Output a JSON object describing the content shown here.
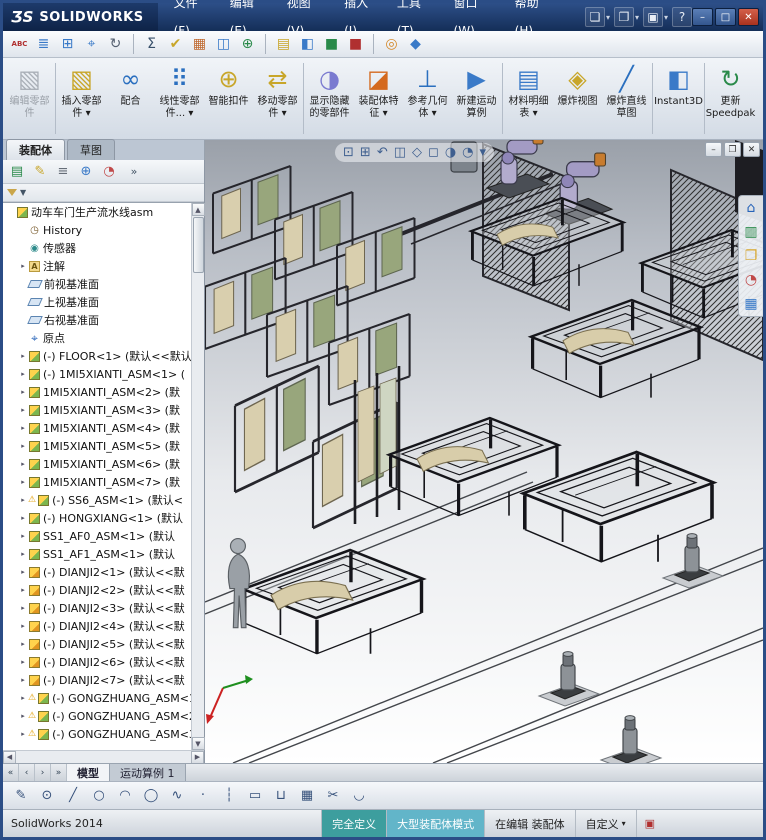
{
  "window": {
    "logo_zs": "ƷS",
    "logo_name": "SOLIDWORKS",
    "menus": [
      "文件(F)",
      "编辑(E)",
      "视图(V)",
      "插入(I)",
      "工具(T)",
      "窗口(W)",
      "帮助(H)"
    ],
    "quick_icons": [
      {
        "name": "new-document-icon",
        "glyph": "❏",
        "arrow": true
      },
      {
        "name": "open-document-icon",
        "glyph": "❐",
        "arrow": true
      },
      {
        "name": "save-icon",
        "glyph": "▣",
        "arrow": true
      },
      {
        "name": "help-icon",
        "glyph": "?"
      }
    ],
    "controls": [
      {
        "name": "minimize-button",
        "glyph": "–",
        "kind": "min"
      },
      {
        "name": "maximize-button",
        "glyph": "□",
        "kind": "max"
      },
      {
        "name": "close-button",
        "glyph": "✕",
        "kind": "close"
      }
    ]
  },
  "toolbar2": {
    "icons": [
      {
        "name": "spellcheck-icon",
        "glyph": "ABC",
        "color": "#b03030",
        "small": true
      },
      {
        "name": "file-properties-icon",
        "glyph": "≣",
        "color": "#3a7ac8"
      },
      {
        "name": "grid-settings-icon",
        "glyph": "⊞",
        "color": "#3a7ac8"
      },
      {
        "name": "measure-icon",
        "glyph": "⌖",
        "color": "#3a7ac8"
      },
      {
        "name": "reload-icon",
        "glyph": "↻",
        "color": "#556070"
      },
      {
        "sep": true
      },
      {
        "name": "equations-icon",
        "glyph": "Σ",
        "color": "#38506a"
      },
      {
        "name": "check-document-icon",
        "glyph": "✔",
        "color": "#c8a62a"
      },
      {
        "name": "section-properties-icon",
        "glyph": "▦",
        "color": "#c06a30"
      },
      {
        "name": "interference-detection-icon",
        "glyph": "◫",
        "color": "#3a7ac8"
      },
      {
        "name": "hole-alignment-icon",
        "glyph": "⊕",
        "color": "#2a8a4a"
      },
      {
        "sep": true
      },
      {
        "name": "bom-icon",
        "glyph": "▤",
        "color": "#c8a62a"
      },
      {
        "name": "assembly-visualization-icon",
        "glyph": "◧",
        "color": "#3a7ac8"
      },
      {
        "name": "simulation-icon",
        "glyph": "■",
        "color": "#2a8a4a"
      },
      {
        "name": "motion-icon",
        "glyph": "■",
        "color": "#b03030"
      },
      {
        "sep": true
      },
      {
        "name": "appearances-icon",
        "glyph": "◎",
        "color": "#d4892a"
      },
      {
        "name": "scene-icon",
        "glyph": "◆",
        "color": "#3a7ac8"
      }
    ]
  },
  "command_manager": {
    "buttons": [
      {
        "name": "edit-component-button",
        "label": "编辑零部件",
        "glyph": "▧",
        "color": "#8a949e",
        "disabled": true
      },
      {
        "name": "insert-components-button",
        "label": "插入零部件",
        "glyph": "▧",
        "color": "#c8a62a",
        "arrow": true,
        "sep_before": true
      },
      {
        "name": "mate-button",
        "label": "配合",
        "glyph": "∞",
        "color": "#2a6fbf"
      },
      {
        "name": "linear-component-pattern-button",
        "label": "线性零部件...",
        "glyph": "⠿",
        "color": "#2a6fbf",
        "arrow": true
      },
      {
        "name": "smart-fasteners-button",
        "label": "智能扣件",
        "glyph": "⊕",
        "color": "#c8a62a"
      },
      {
        "name": "move-component-button",
        "label": "移动零部件",
        "glyph": "⇄",
        "color": "#c8a62a",
        "arrow": true
      },
      {
        "name": "show-hidden-components-button",
        "label": "显示隐藏的零部件",
        "glyph": "◑",
        "color": "#7a7ad0",
        "sep_before": true
      },
      {
        "name": "assembly-features-button",
        "label": "装配体特征",
        "glyph": "◪",
        "color": "#d4691e",
        "arrow": true
      },
      {
        "name": "reference-geometry-button",
        "label": "参考几何体",
        "glyph": "⊥",
        "color": "#2a6fbf",
        "arrow": true
      },
      {
        "name": "new-motion-study-button",
        "label": "新建运动算例",
        "glyph": "▶",
        "color": "#3a7ac8"
      },
      {
        "name": "bill-of-materials-button",
        "label": "材料明细表",
        "glyph": "▤",
        "color": "#3a7ac8",
        "arrow": true,
        "sep_before": true
      },
      {
        "name": "exploded-view-button",
        "label": "爆炸视图",
        "glyph": "◈",
        "color": "#c8a62a"
      },
      {
        "name": "explode-line-sketch-button",
        "label": "爆炸直线草图",
        "glyph": "╱",
        "color": "#2a6fbf"
      },
      {
        "name": "instant3d-button",
        "label": "Instant3D",
        "glyph": "◧",
        "color": "#3a7ac8",
        "sep_before": true
      },
      {
        "name": "update-speedpak-button",
        "label": "更新 Speedpak",
        "glyph": "↻",
        "color": "#2a8a4a",
        "sep_before": true
      }
    ]
  },
  "cm_tabs": [
    {
      "label": "装配体",
      "active": true
    },
    {
      "label": "草图",
      "active": false
    }
  ],
  "feature_panel": {
    "tab_icons": [
      {
        "name": "featuremanager-tab-icon",
        "glyph": "▤",
        "color": "#2a8a4a"
      },
      {
        "name": "propertymanager-tab-icon",
        "glyph": "✎",
        "color": "#c8a62a"
      },
      {
        "name": "configurationmanager-tab-icon",
        "glyph": "≡",
        "color": "#666e78"
      },
      {
        "name": "dimxpertmanager-tab-icon",
        "glyph": "⊕",
        "color": "#3a7ac8"
      },
      {
        "name": "displaymanager-tab-icon",
        "glyph": "◔",
        "color": "#c04a4a"
      },
      {
        "name": "panel-expand-chevron-icon",
        "glyph": "»",
        "color": "#445566",
        "chev": true
      }
    ],
    "filter_arrow": "▼",
    "icon_glyphs": {
      "origin": "⌖",
      "history": "◷",
      "sensor": "◉",
      "note": "A"
    },
    "tree": {
      "items": [
        {
          "label": "动车车门生产流水线asm",
          "icon": "asm-root",
          "root": true
        },
        {
          "label": "History",
          "icon": "history"
        },
        {
          "label": "传感器",
          "icon": "sensor"
        },
        {
          "label": "注解",
          "icon": "note",
          "expand": true
        },
        {
          "label": "前视基准面",
          "icon": "plane"
        },
        {
          "label": "上视基准面",
          "icon": "plane"
        },
        {
          "label": "右视基准面",
          "icon": "plane"
        },
        {
          "label": "原点",
          "icon": "origin"
        },
        {
          "label": "(-) FLOOR<1> (默认<<默认",
          "icon": "asm",
          "expand": true
        },
        {
          "label": "(-) 1MI5XIANTI_ASM<1> (",
          "icon": "asm",
          "expand": true
        },
        {
          "label": "1MI5XIANTI_ASM<2> (默",
          "icon": "asm",
          "expand": true
        },
        {
          "label": "1MI5XIANTI_ASM<3> (默",
          "icon": "asm",
          "expand": true
        },
        {
          "label": "1MI5XIANTI_ASM<4> (默",
          "icon": "asm",
          "expand": true
        },
        {
          "label": "1MI5XIANTI_ASM<5> (默",
          "icon": "asm",
          "expand": true
        },
        {
          "label": "1MI5XIANTI_ASM<6> (默",
          "icon": "asm",
          "expand": true
        },
        {
          "label": "1MI5XIANTI_ASM<7> (默",
          "icon": "asm",
          "expand": true
        },
        {
          "label": "(-) SS6_ASM<1> (默认<",
          "icon": "asm",
          "expand": true,
          "warn": true
        },
        {
          "label": "(-) HONGXIANG<1> (默认",
          "icon": "asm",
          "expand": true
        },
        {
          "label": "SS1_AF0_ASM<1> (默认",
          "icon": "asm",
          "expand": true
        },
        {
          "label": "SS1_AF1_ASM<1> (默认",
          "icon": "asm",
          "expand": true
        },
        {
          "label": "(-) DIANJI2<1> (默认<<默",
          "icon": "part",
          "expand": true
        },
        {
          "label": "(-) DIANJI2<2> (默认<<默",
          "icon": "part",
          "expand": true
        },
        {
          "label": "(-) DIANJI2<3> (默认<<默",
          "icon": "part",
          "expand": true
        },
        {
          "label": "(-) DIANJI2<4> (默认<<默",
          "icon": "part",
          "expand": true
        },
        {
          "label": "(-) DIANJI2<5> (默认<<默",
          "icon": "part",
          "expand": true
        },
        {
          "label": "(-) DIANJI2<6> (默认<<默",
          "icon": "part",
          "expand": true
        },
        {
          "label": "(-) DIANJI2<7> (默认<<默",
          "icon": "part",
          "expand": true
        },
        {
          "label": "(-) GONGZHUANG_ASM<1",
          "icon": "asm",
          "expand": true,
          "warn": true
        },
        {
          "label": "(-) GONGZHUANG_ASM<2",
          "icon": "asm",
          "expand": true,
          "warn": true
        },
        {
          "label": "(-) GONGZHUANG_ASM<3",
          "icon": "asm",
          "expand": true,
          "warn": true
        }
      ]
    }
  },
  "viewport": {
    "headsup": [
      {
        "name": "zoom-fit-icon",
        "glyph": "⊡"
      },
      {
        "name": "zoom-area-icon",
        "glyph": "⊞"
      },
      {
        "name": "previous-view-icon",
        "glyph": "↶"
      },
      {
        "name": "section-view-icon",
        "glyph": "◫"
      },
      {
        "name": "view-orientation-icon",
        "glyph": "◇"
      },
      {
        "name": "display-style-icon",
        "glyph": "◻"
      },
      {
        "name": "hide-show-items-icon",
        "glyph": "◑"
      },
      {
        "name": "edit-appearance-icon",
        "glyph": "◔"
      },
      {
        "name": "view-settings-icon",
        "glyph": "▾"
      }
    ],
    "doc_controls": [
      {
        "name": "doc-minimize-icon",
        "glyph": "–"
      },
      {
        "name": "doc-restore-icon",
        "glyph": "❐"
      },
      {
        "name": "doc-close-icon",
        "glyph": "✕"
      }
    ],
    "taskpane": [
      {
        "name": "solidworks-resources-icon",
        "glyph": "⌂",
        "color": "#2663b8"
      },
      {
        "name": "design-library-icon",
        "glyph": "▥",
        "color": "#2a8a4a"
      },
      {
        "name": "file-explorer-icon",
        "glyph": "❐",
        "color": "#d8a72e"
      },
      {
        "name": "appearances-panel-icon",
        "glyph": "◔",
        "color": "#c04a4a"
      },
      {
        "name": "view-palette-icon",
        "glyph": "▦",
        "color": "#3a7ac8"
      }
    ]
  },
  "bottom": {
    "nav": [
      "«",
      "‹",
      "›",
      "»"
    ],
    "tabs": [
      {
        "label": "模型",
        "active": true
      },
      {
        "label": "运动算例 1",
        "active": false
      }
    ],
    "sketch_tools": [
      {
        "name": "sketch-icon",
        "glyph": "✎"
      },
      {
        "name": "smart-dimension-icon",
        "glyph": "⊙"
      },
      {
        "name": "line-icon",
        "glyph": "╱"
      },
      {
        "name": "circle-icon",
        "glyph": "○"
      },
      {
        "name": "arc-icon",
        "glyph": "◠"
      },
      {
        "name": "ellipse-icon",
        "glyph": "◯"
      },
      {
        "name": "spline-icon",
        "glyph": "∿"
      },
      {
        "name": "point-icon",
        "glyph": "·"
      },
      {
        "name": "centerline-icon",
        "glyph": "┆"
      },
      {
        "name": "corner-rectangle-icon",
        "glyph": "▭"
      },
      {
        "name": "straight-slot-icon",
        "glyph": "⊔"
      },
      {
        "name": "linear-pattern-icon",
        "glyph": "▦"
      },
      {
        "name": "trim-entities-icon",
        "glyph": "✂"
      },
      {
        "name": "sketch-fillet-icon",
        "glyph": "◡"
      }
    ]
  },
  "statusbar": {
    "left": "SolidWorks 2014",
    "defined": "完全定义",
    "lam": "大型装配体模式",
    "editing": "在编辑 装配体",
    "custom": "自定义"
  },
  "ui": {
    "dropdown_arrow": "▾",
    "tree_expander": "▸",
    "warning_glyph": "⚠",
    "scroll_up": "▲",
    "scroll_down": "▼",
    "scroll_left": "◀",
    "scroll_right": "▶",
    "status_tag_glyph": "▣",
    "custom_arrow": "▾"
  }
}
